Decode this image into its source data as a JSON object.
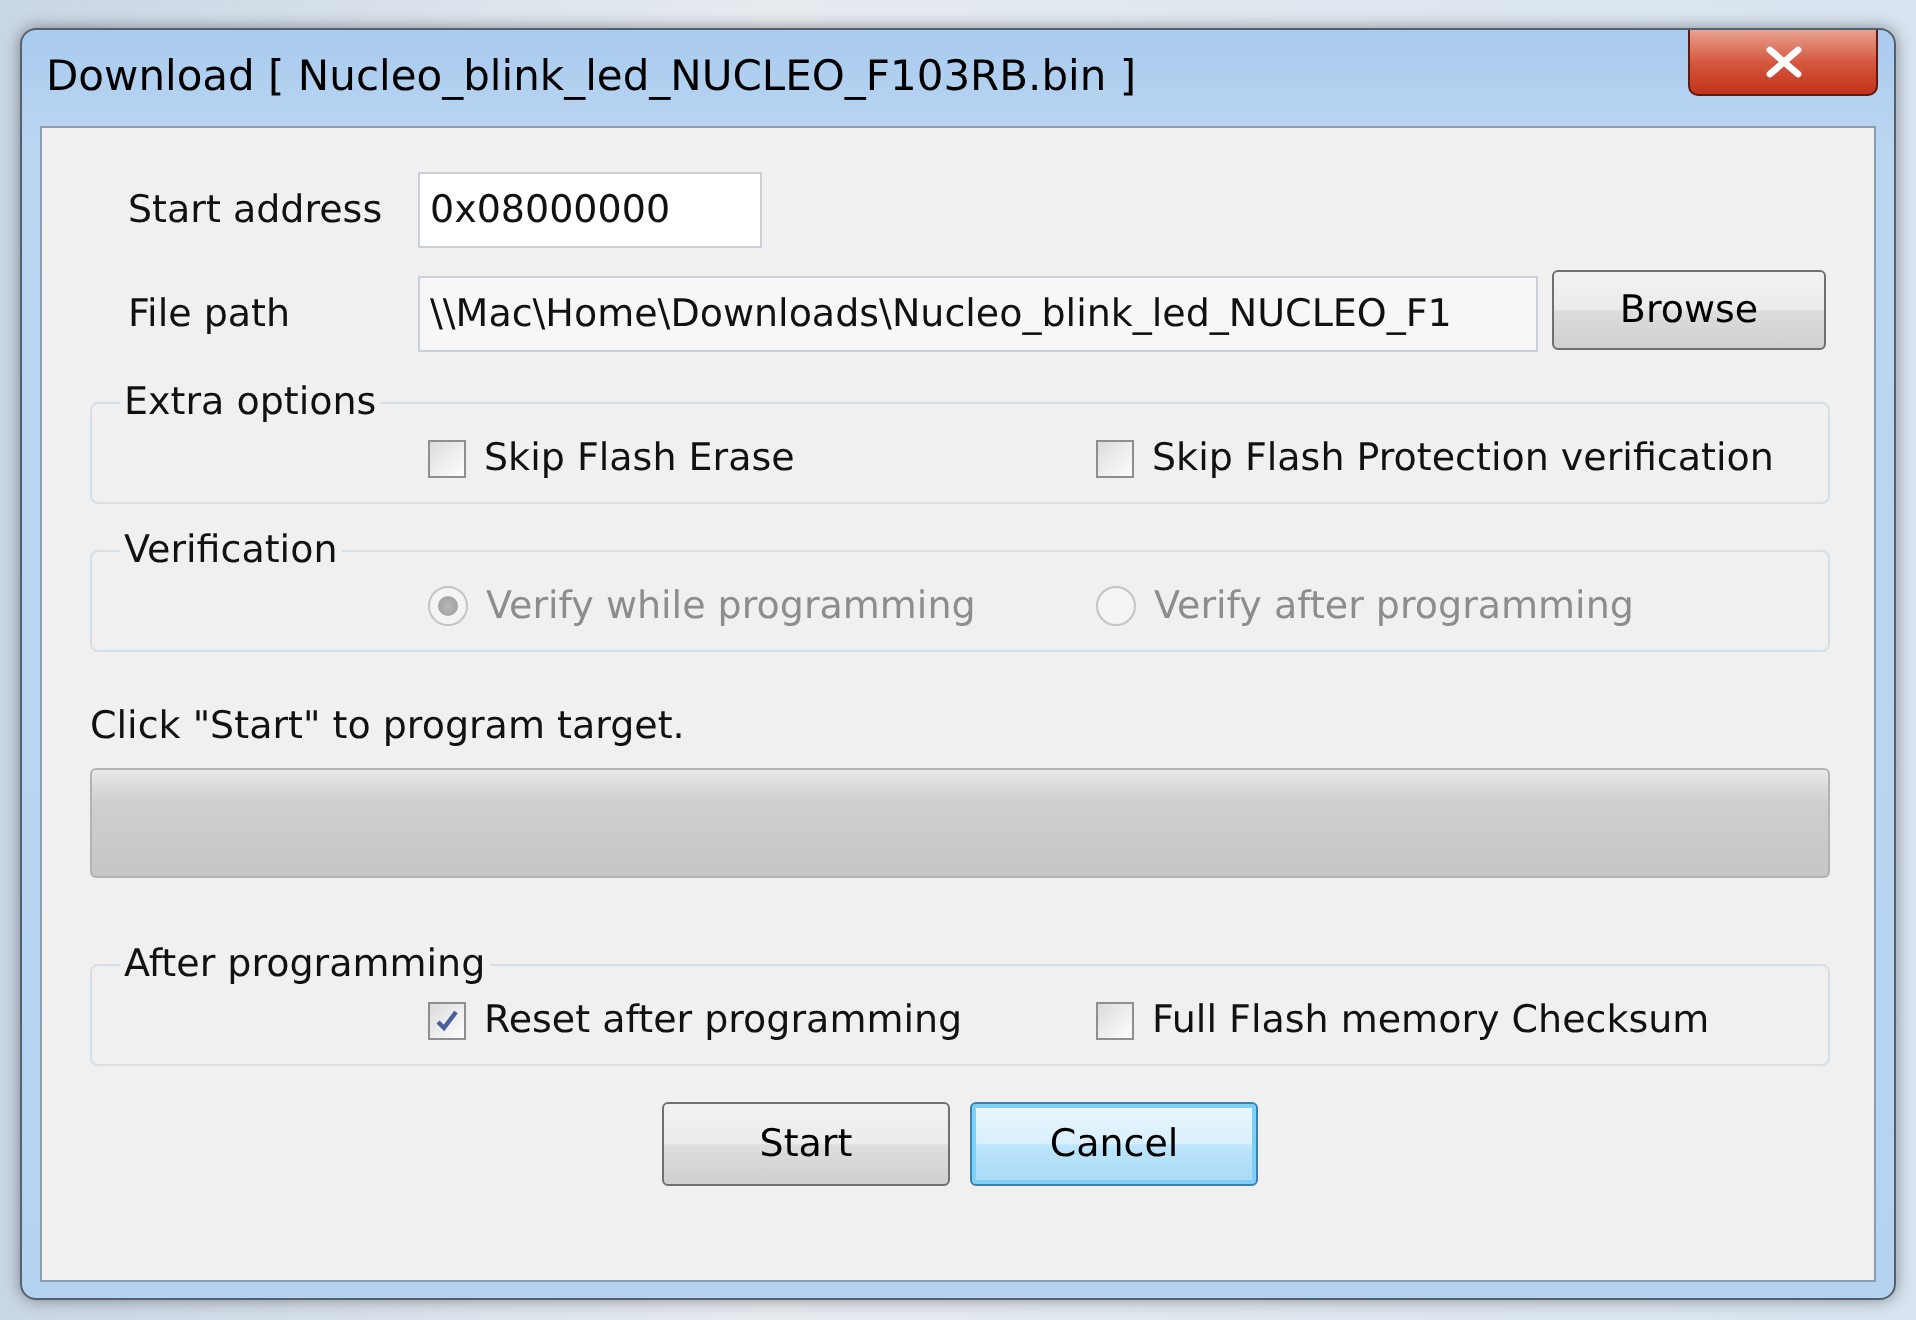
{
  "window": {
    "title": "Download [ Nucleo_blink_led_NUCLEO_F103RB.bin ]"
  },
  "fields": [
    {
      "label": "Start address",
      "value": "0x08000000",
      "kind": "short"
    },
    {
      "label": "File path",
      "value": "\\\\Mac\\Home\\Downloads\\Nucleo_blink_led_NUCLEO_F1",
      "kind": "long",
      "button": "Browse"
    }
  ],
  "extra_options": {
    "legend": "Extra options",
    "options": [
      {
        "label": "Skip Flash Erase",
        "checked": false
      },
      {
        "label": "Skip Flash Protection verification",
        "checked": false
      }
    ]
  },
  "verification": {
    "legend": "Verification",
    "disabled": true,
    "options": [
      {
        "label": "Verify while programming",
        "selected": true
      },
      {
        "label": "Verify after programming",
        "selected": false
      }
    ]
  },
  "status": "Click \"Start\" to program target.",
  "progress": {
    "level": 0
  },
  "after_programming": {
    "legend": "After programming",
    "options": [
      {
        "label": "Reset after programming",
        "checked": true
      },
      {
        "label": "Full Flash memory Checksum",
        "checked": false
      }
    ]
  },
  "buttons": [
    {
      "label": "Start",
      "focused": false
    },
    {
      "label": "Cancel",
      "focused": true
    }
  ]
}
